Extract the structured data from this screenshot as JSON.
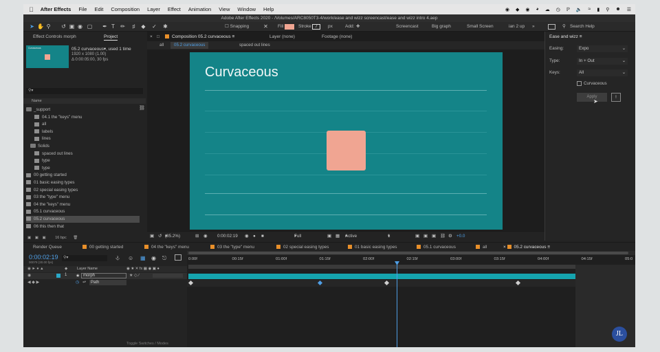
{
  "menubar": {
    "app_name": "After Effects",
    "items": [
      "File",
      "Edit",
      "Composition",
      "Layer",
      "Effect",
      "Animation",
      "View",
      "Window",
      "Help"
    ],
    "status": {
      "battery": "100%",
      "clock": ""
    }
  },
  "titlebar": {
    "text": "Adobe After Effects 2020 - /Volumes/ARC8050T3-4/work/ease and wizz screencast/ease and wizz intro 4.aep"
  },
  "toolbar": {
    "snapping": "Snapping",
    "fill": "Fill",
    "stroke": "Stroke",
    "stroke_value": "7",
    "px": "px",
    "add": "Add:",
    "workspace_active": "Screencast",
    "workspaces": [
      "Big graph",
      "Small Screen",
      "ian 2 up"
    ],
    "search_help": "Search Help"
  },
  "project_panel": {
    "tabs": [
      "Effect Controls morph",
      "Project"
    ],
    "thumbnail_label": "Curvaceous",
    "comp_name": "05.2 curvaceous",
    "used": ", used 1 time",
    "dimensions": "1920 x 1080 (1.00)",
    "duration": "Δ 0:00:05:00, 30 fps",
    "column_header": "Name",
    "items": [
      {
        "name": "_support",
        "type": "folder",
        "indent": 0
      },
      {
        "name": "04.1 the \"keys\" menu",
        "type": "comp",
        "indent": 2
      },
      {
        "name": "all",
        "type": "comp",
        "indent": 2
      },
      {
        "name": "labels",
        "type": "comp",
        "indent": 2
      },
      {
        "name": "lines",
        "type": "comp",
        "indent": 2
      },
      {
        "name": "Solids",
        "type": "folder",
        "indent": 1
      },
      {
        "name": "spaced out lines",
        "type": "comp",
        "indent": 2
      },
      {
        "name": "type",
        "type": "comp",
        "indent": 2
      },
      {
        "name": "type",
        "type": "comp",
        "indent": 2
      },
      {
        "name": "00 getting started",
        "type": "comp",
        "indent": 0
      },
      {
        "name": "01 basic easing types",
        "type": "comp",
        "indent": 0
      },
      {
        "name": "02 special easing types",
        "type": "comp",
        "indent": 0
      },
      {
        "name": "03 the \"type\" menu",
        "type": "comp",
        "indent": 0
      },
      {
        "name": "04 the \"keys\" menu",
        "type": "comp",
        "indent": 0
      },
      {
        "name": "05.1 curvaceous",
        "type": "comp",
        "indent": 0
      },
      {
        "name": "05.2 curvaceous",
        "type": "comp",
        "indent": 0,
        "selected": true
      },
      {
        "name": "06 this then that",
        "type": "comp",
        "indent": 0
      }
    ],
    "bpc": "16 bpc"
  },
  "viewer": {
    "tabs": [
      "Composition 05.2 curvaceous",
      "Layer (none)",
      "Footage (none)"
    ],
    "breadcrumbs": [
      "all",
      "05.2 curvaceous",
      "spaced out lines"
    ],
    "comp_title": "Curvaceous",
    "zoom": "(85.2%)",
    "timecode": "0:00:02:19",
    "resolution": "Full",
    "camera": "Active Camera",
    "views": "1 View",
    "exposure": "+0.0"
  },
  "ease_panel": {
    "title": "Ease and wizz",
    "easing_label": "Easing:",
    "easing_value": "Expo",
    "type_label": "Type:",
    "type_value": "In + Out",
    "keys_label": "Keys:",
    "keys_value": "All",
    "curvaceous_label": "Curvaceous",
    "apply_label": "Apply",
    "help_label": "!"
  },
  "timeline": {
    "tabs": [
      "Render Queue",
      "00 getting started",
      "04 the \"keys\" menu",
      "03 the \"type\" menu",
      "02 special easing types",
      "01 basic easing types",
      "05.1 curvaceous",
      "all",
      "05.2 curvaceous"
    ],
    "current_time": "0:00:02:19",
    "frame_info": "00079 (30.00 fps)",
    "layer_name_header": "Layer Name",
    "layer_number": "1",
    "layer_name": "morph",
    "property": "Path",
    "ruler": [
      "0:00f",
      "00:15f",
      "01:00f",
      "01:15f",
      "02:00f",
      "02:15f",
      "03:00f",
      "03:15f",
      "04:00f",
      "04:15f",
      "05:0"
    ],
    "footer": "Toggle Switches / Modes"
  },
  "avatar": {
    "initials": "JL"
  }
}
